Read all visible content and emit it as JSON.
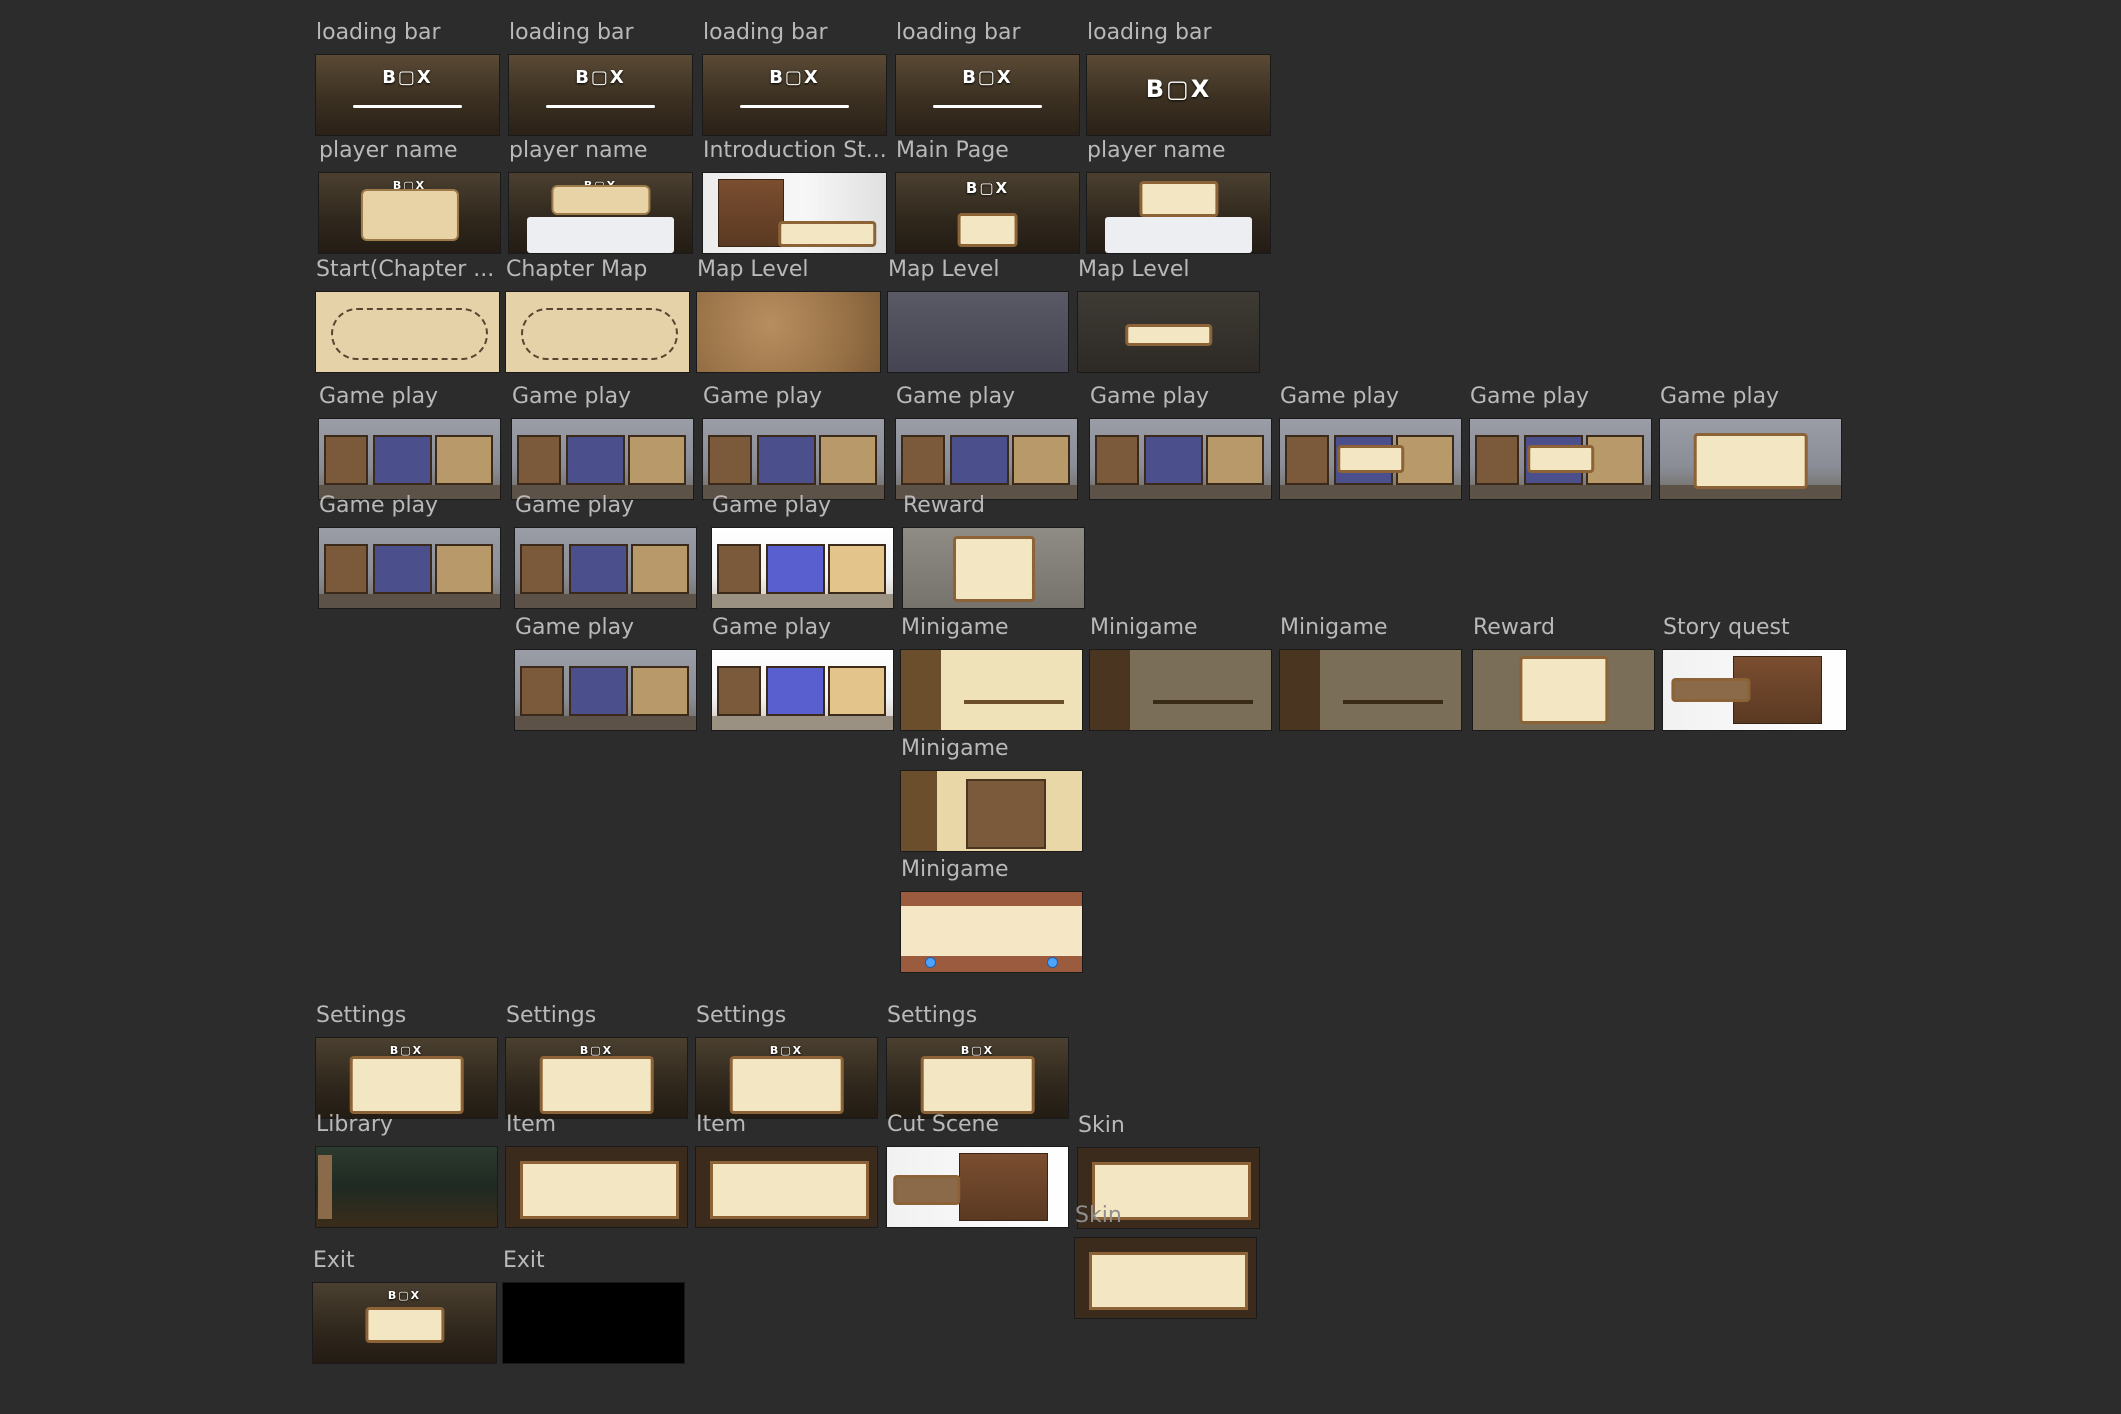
{
  "frames": [
    {
      "label": "loading bar",
      "theme": "loading"
    },
    {
      "label": "loading bar",
      "theme": "loading"
    },
    {
      "label": "loading bar",
      "theme": "loading"
    },
    {
      "label": "loading bar",
      "theme": "loading"
    },
    {
      "label": "loading bar",
      "theme": "loading"
    },
    {
      "label": "player name",
      "theme": "dark"
    },
    {
      "label": "player name",
      "theme": "dark"
    },
    {
      "label": "Introduction St...",
      "theme": "intro"
    },
    {
      "label": "Main Page",
      "theme": "dark"
    },
    {
      "label": "player name",
      "theme": "dark"
    },
    {
      "label": "Start(Chapter ...",
      "theme": "map"
    },
    {
      "label": "Chapter Map",
      "theme": "map"
    },
    {
      "label": "Map Level",
      "theme": "terrain"
    },
    {
      "label": "Map Level",
      "theme": "city"
    },
    {
      "label": "Map Level",
      "theme": "citydim"
    },
    {
      "label": "Game play",
      "theme": "game"
    },
    {
      "label": "Game play",
      "theme": "game"
    },
    {
      "label": "Game play",
      "theme": "game"
    },
    {
      "label": "Game play",
      "theme": "game"
    },
    {
      "label": "Game play",
      "theme": "game"
    },
    {
      "label": "Game play",
      "theme": "game"
    },
    {
      "label": "Game play",
      "theme": "game"
    },
    {
      "label": "Game play",
      "theme": "game"
    },
    {
      "label": "Game play",
      "theme": "game"
    },
    {
      "label": "Game play",
      "theme": "game"
    },
    {
      "label": "Game play",
      "theme": "gamebr"
    },
    {
      "label": "Reward",
      "theme": "reward"
    },
    {
      "label": "Game play",
      "theme": "game"
    },
    {
      "label": "Game play",
      "theme": "gamebr"
    },
    {
      "label": "Minigame",
      "theme": "mini"
    },
    {
      "label": "Minigame",
      "theme": "minidim"
    },
    {
      "label": "Minigame",
      "theme": "minidim"
    },
    {
      "label": "Reward",
      "theme": "reward"
    },
    {
      "label": "Story quest",
      "theme": "story"
    },
    {
      "label": "Minigame",
      "theme": "maze"
    },
    {
      "label": "Minigame",
      "theme": "runner"
    },
    {
      "label": "Settings",
      "theme": "dark"
    },
    {
      "label": "Settings",
      "theme": "dark"
    },
    {
      "label": "Settings",
      "theme": "dark"
    },
    {
      "label": "Settings",
      "theme": "dark"
    },
    {
      "label": "Library",
      "theme": "library"
    },
    {
      "label": "Item",
      "theme": "item"
    },
    {
      "label": "Item",
      "theme": "item"
    },
    {
      "label": "Cut Scene",
      "theme": "story"
    },
    {
      "label": "Skin",
      "theme": "skin"
    },
    {
      "label": "Skin",
      "theme": "skin"
    },
    {
      "label": "Exit",
      "theme": "dark"
    },
    {
      "label": "Exit",
      "theme": "black"
    }
  ]
}
